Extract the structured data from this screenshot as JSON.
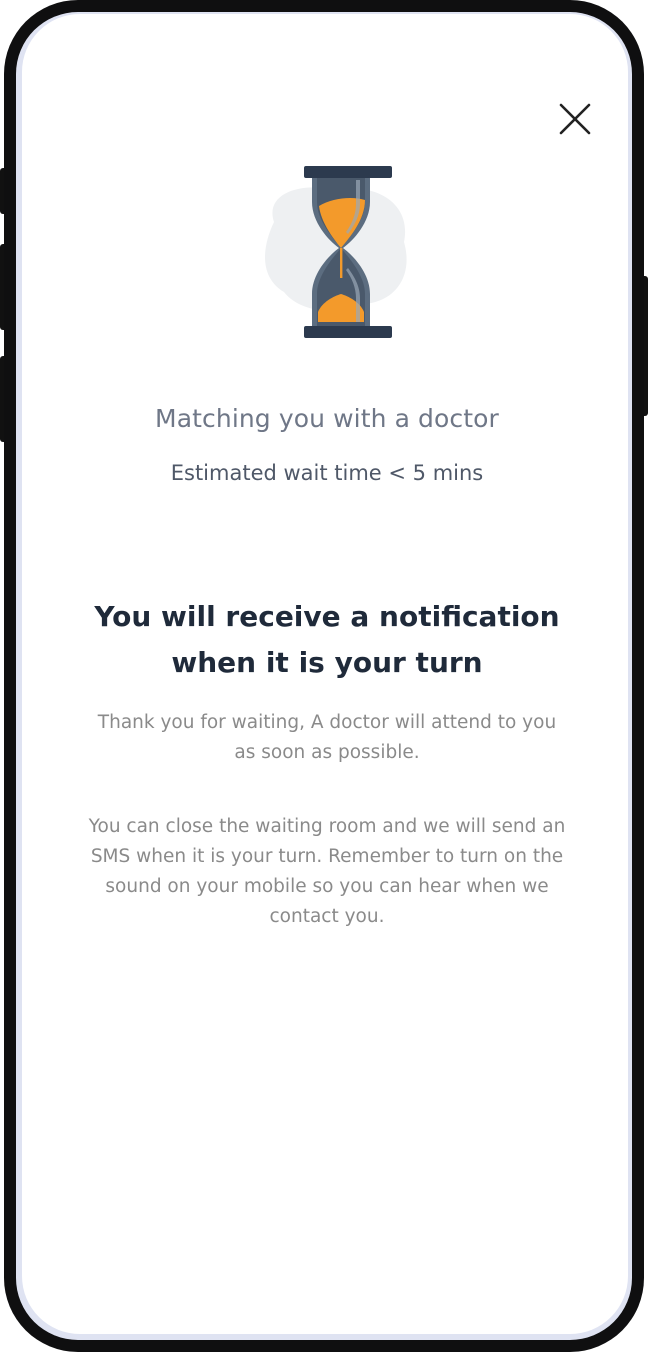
{
  "close": {
    "icon": "close-icon"
  },
  "illustration": {
    "icon": "hourglass-icon",
    "colors": {
      "frame": "#2c3a4e",
      "sand": "#f39a2b",
      "glass": "#5c6d80",
      "blob": "#eef0f2"
    }
  },
  "status": {
    "title": "Matching you with a doctor",
    "wait_time": "Estimated wait time < 5 mins"
  },
  "notice": {
    "headline": "You will receive a notification when it is your turn",
    "paragraph_1": "Thank you for waiting, A doctor will attend to you as soon as possible.",
    "paragraph_2": "You can close the waiting room and we will send an SMS when it is your turn. Remember to turn on the sound on your mobile so you can hear when we contact you."
  }
}
